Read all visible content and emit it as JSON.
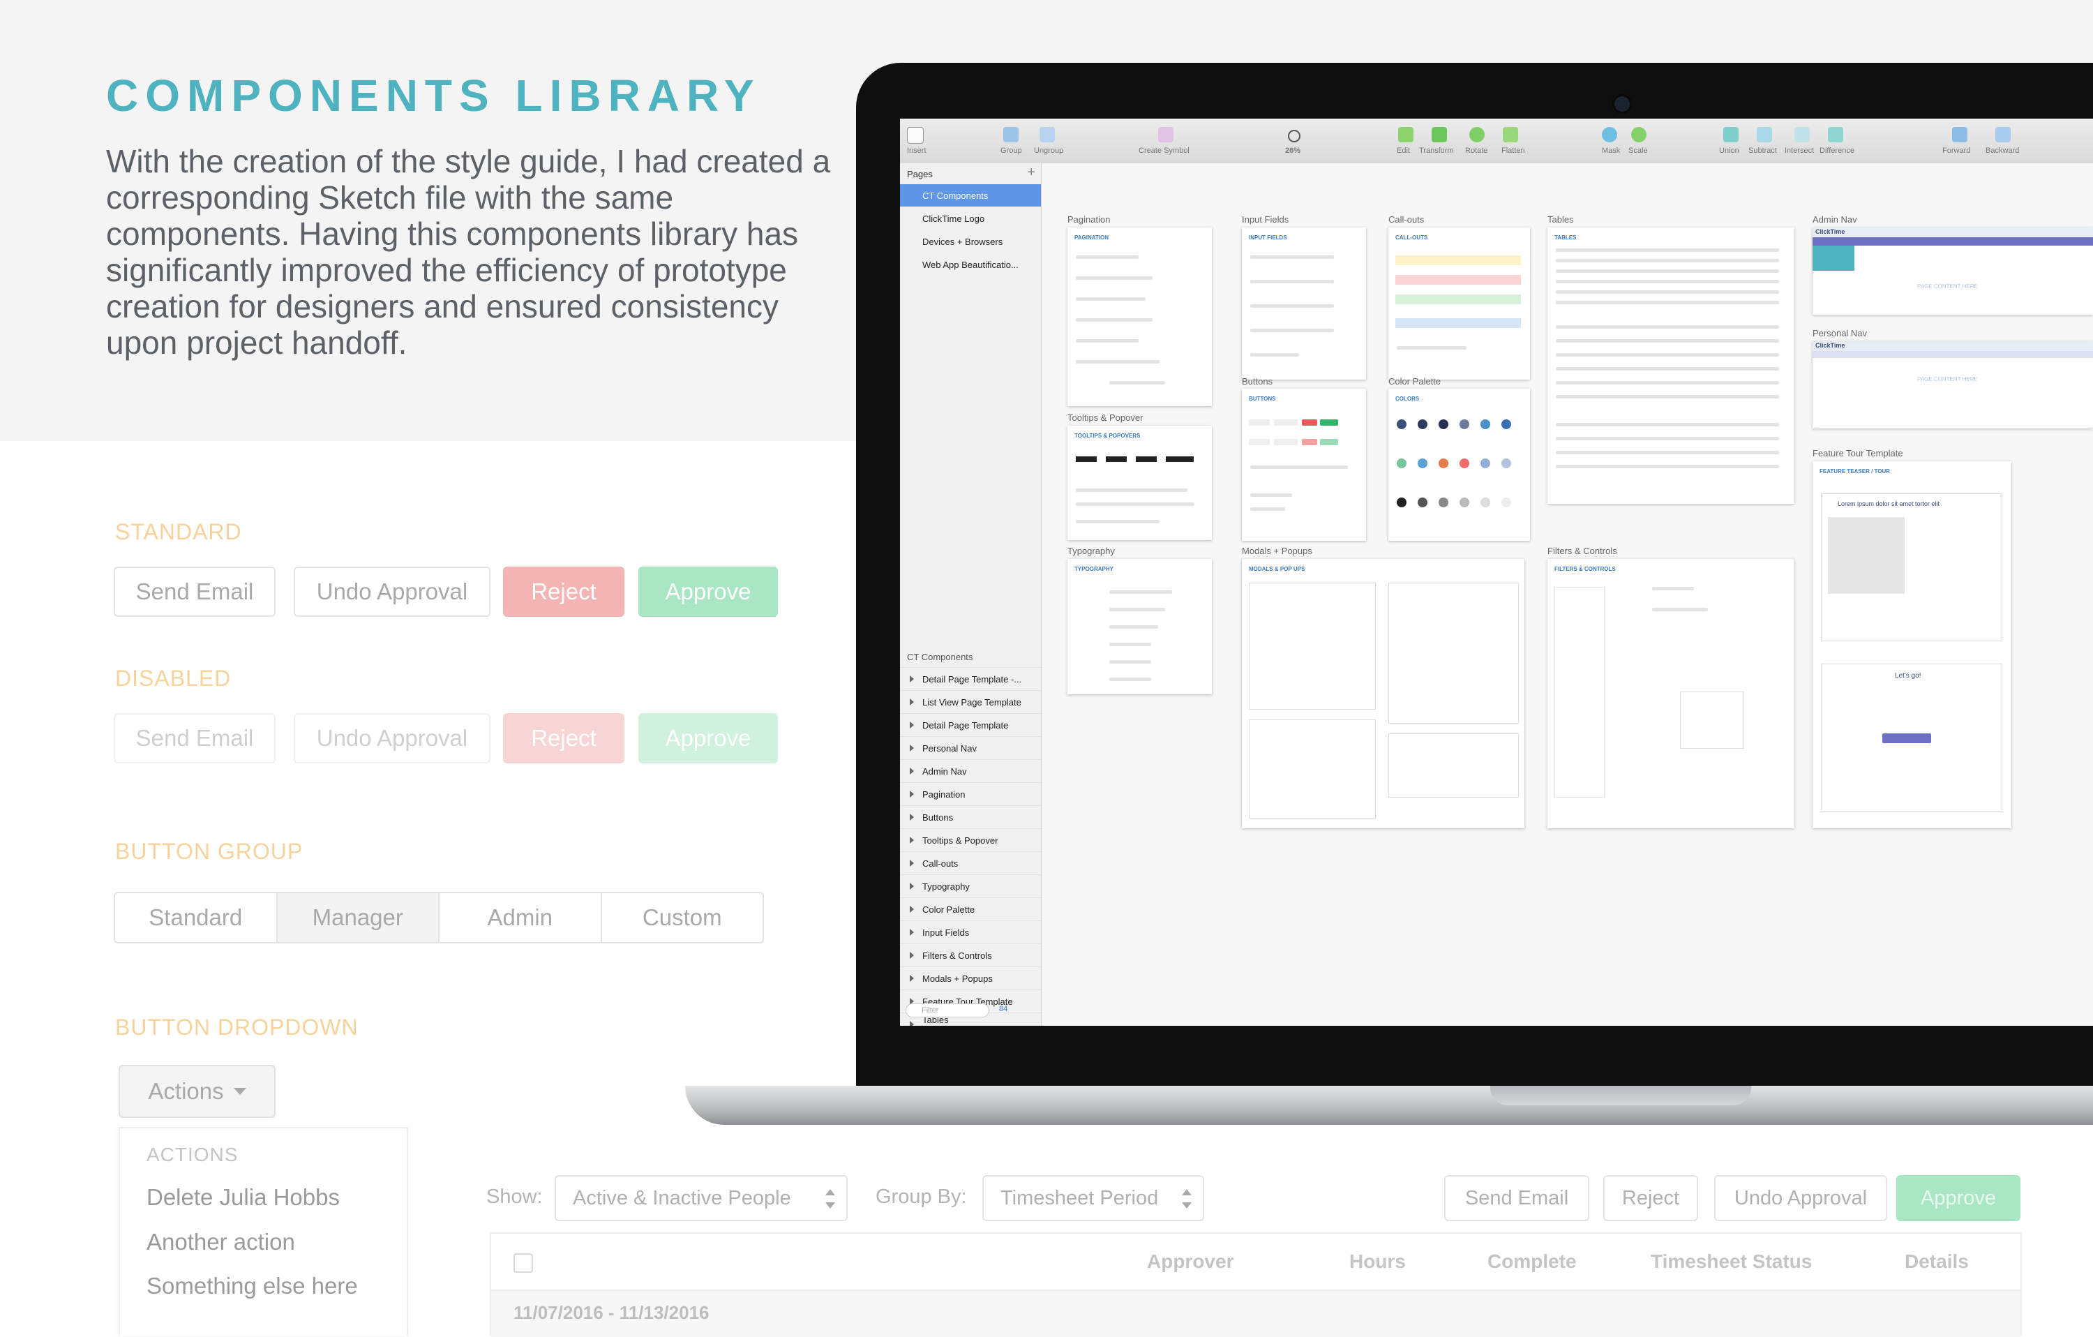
{
  "header": {
    "title": "COMPONENTS LIBRARY",
    "description": "With the creation of the style guide, I had created a corresponding Sketch file with the same components. Having this components library has significantly improved the efficiency of prototype creation for designers  and ensured consistency upon project handoff."
  },
  "demo": {
    "standard_label": "STANDARD",
    "disabled_label": "DISABLED",
    "button_group_label": "BUTTON GROUP",
    "button_dropdown_label": "BUTTON DROPDOWN",
    "buttons": {
      "send_email": "Send Email",
      "undo_approval": "Undo Approval",
      "reject": "Reject",
      "approve": "Approve"
    },
    "group": [
      "Standard",
      "Manager",
      "Admin",
      "Custom"
    ],
    "group_active": "Manager",
    "dropdown": {
      "label": "Actions",
      "header": "ACTIONS",
      "items": [
        "Delete Julia Hobbs",
        "Another action",
        "Something else here"
      ]
    }
  },
  "filters": {
    "show_label": "Show:",
    "show_value": "Active & Inactive People",
    "group_by_label": "Group By:",
    "group_by_value": "Timesheet Period",
    "actions": [
      "Send Email",
      "Reject",
      "Undo Approval",
      "Approve"
    ]
  },
  "table": {
    "columns": [
      "Approver",
      "Hours",
      "Complete",
      "Timesheet Status",
      "Details"
    ],
    "group_row": "11/07/2016 - 11/13/2016"
  },
  "sketch": {
    "toolbar": [
      "Insert",
      "Group",
      "Ungroup",
      "Create Symbol",
      "26%",
      "Edit",
      "Transform",
      "Rotate",
      "Flatten",
      "Mask",
      "Scale",
      "Union",
      "Subtract",
      "Intersect",
      "Difference",
      "Forward",
      "Backward"
    ],
    "pages_header": "Pages",
    "pages": [
      "CT Components",
      "ClickTime Logo",
      "Devices + Browsers",
      "Web App Beautificatio..."
    ],
    "selected_page": "CT Components",
    "artboards_header": "CT Components",
    "artboards": [
      "Detail Page Template -...",
      "List View Page Template",
      "Detail Page Template",
      "Personal Nav",
      "Admin Nav",
      "Pagination",
      "Buttons",
      "Tooltips & Popover",
      "Call-outs",
      "Typography",
      "Color Palette",
      "Input Fields",
      "Filters & Controls",
      "Modals + Popups",
      "Feature Tour Template",
      "Tables"
    ],
    "filter_placeholder": "Filter",
    "layer_count": "84",
    "canvas_titles": {
      "pagination": "Pagination",
      "input_fields": "Input Fields",
      "callouts": "Call-outs",
      "tables": "Tables",
      "admin_nav": "Admin Nav",
      "personal_nav": "Personal Nav",
      "buttons": "Buttons",
      "color_palette": "Color Palette",
      "tooltips": "Tooltips & Popover",
      "typography": "Typography",
      "modals": "Modals + Popups",
      "filters": "Filters & Controls",
      "feature_tour": "Feature Tour Template"
    },
    "artboard_headers": {
      "pagination": "PAGINATION",
      "input_fields": "INPUT FIELDS",
      "callouts": "CALL-OUTS",
      "tables": "TABLES",
      "buttons": "BUTTONS",
      "colors": "COLORS",
      "tooltips": "TOOLTIPS & POPOVERS",
      "typography": "TYPOGRAPHY",
      "modals": "MODALS & POP UPS",
      "filters": "FILTERS & CONTROLS",
      "feature_tour": "FEATURE TEASER / TOUR"
    },
    "nav_logo": "ClickTime",
    "page_content": "PAGE CONTENT HERE",
    "tour_heading": "Lorem ipsum dolor sit amet tortor elit",
    "tour_cta": "Let's go!"
  },
  "colors": {
    "title": "#4fb3bf",
    "section_label": "#f6d29c",
    "reject": "#f4b4b4",
    "approve": "#a8e6c4",
    "selection_blue": "#5d96e7",
    "palette": [
      "#3d4f7c",
      "#2d3b63",
      "#293058",
      "#6a7899",
      "#4a90c8",
      "#3a6fb5",
      "#76c4a0",
      "#5aa2d8",
      "#e57b47",
      "#f26b6b",
      "#8fb0dc",
      "#b2c2dd",
      "#222222",
      "#555555",
      "#888888",
      "#bbbbbb",
      "#dddddd",
      "#eeeeee"
    ]
  }
}
